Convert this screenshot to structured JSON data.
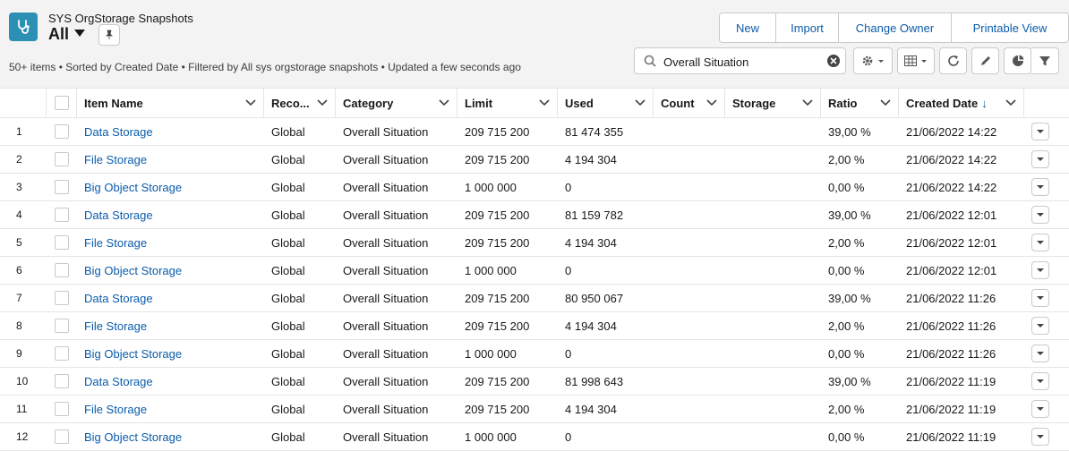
{
  "header": {
    "object_title": "SYS OrgStorage Snapshots",
    "view_name": "All",
    "meta": "50+ items • Sorted by Created Date • Filtered by All sys orgstorage snapshots • Updated a few seconds ago",
    "buttons": [
      "New",
      "Import",
      "Change Owner",
      "Printable View"
    ],
    "search_value": "Overall Situation",
    "accent_color": "#2c8fb4",
    "link_color": "#0b5cab"
  },
  "table": {
    "columns": [
      "Item Name",
      "Reco...",
      "Category",
      "Limit",
      "Used",
      "Count",
      "Storage",
      "Ratio",
      "Created Date"
    ],
    "rows": [
      {
        "n": "1",
        "name": "Data Storage",
        "reco": "Global",
        "category": "Overall Situation",
        "limit": "209 715 200",
        "used": "81 474 355",
        "count": "",
        "storage": "",
        "ratio": "39,00 %",
        "created": "21/06/2022 14:22"
      },
      {
        "n": "2",
        "name": "File Storage",
        "reco": "Global",
        "category": "Overall Situation",
        "limit": "209 715 200",
        "used": "4 194 304",
        "count": "",
        "storage": "",
        "ratio": "2,00 %",
        "created": "21/06/2022 14:22"
      },
      {
        "n": "3",
        "name": "Big Object Storage",
        "reco": "Global",
        "category": "Overall Situation",
        "limit": "1 000 000",
        "used": "0",
        "count": "",
        "storage": "",
        "ratio": "0,00 %",
        "created": "21/06/2022 14:22"
      },
      {
        "n": "4",
        "name": "Data Storage",
        "reco": "Global",
        "category": "Overall Situation",
        "limit": "209 715 200",
        "used": "81 159 782",
        "count": "",
        "storage": "",
        "ratio": "39,00 %",
        "created": "21/06/2022 12:01"
      },
      {
        "n": "5",
        "name": "File Storage",
        "reco": "Global",
        "category": "Overall Situation",
        "limit": "209 715 200",
        "used": "4 194 304",
        "count": "",
        "storage": "",
        "ratio": "2,00 %",
        "created": "21/06/2022 12:01"
      },
      {
        "n": "6",
        "name": "Big Object Storage",
        "reco": "Global",
        "category": "Overall Situation",
        "limit": "1 000 000",
        "used": "0",
        "count": "",
        "storage": "",
        "ratio": "0,00 %",
        "created": "21/06/2022 12:01"
      },
      {
        "n": "7",
        "name": "Data Storage",
        "reco": "Global",
        "category": "Overall Situation",
        "limit": "209 715 200",
        "used": "80 950 067",
        "count": "",
        "storage": "",
        "ratio": "39,00 %",
        "created": "21/06/2022 11:26"
      },
      {
        "n": "8",
        "name": "File Storage",
        "reco": "Global",
        "category": "Overall Situation",
        "limit": "209 715 200",
        "used": "4 194 304",
        "count": "",
        "storage": "",
        "ratio": "2,00 %",
        "created": "21/06/2022 11:26"
      },
      {
        "n": "9",
        "name": "Big Object Storage",
        "reco": "Global",
        "category": "Overall Situation",
        "limit": "1 000 000",
        "used": "0",
        "count": "",
        "storage": "",
        "ratio": "0,00 %",
        "created": "21/06/2022 11:26"
      },
      {
        "n": "10",
        "name": "Data Storage",
        "reco": "Global",
        "category": "Overall Situation",
        "limit": "209 715 200",
        "used": "81 998 643",
        "count": "",
        "storage": "",
        "ratio": "39,00 %",
        "created": "21/06/2022 11:19"
      },
      {
        "n": "11",
        "name": "File Storage",
        "reco": "Global",
        "category": "Overall Situation",
        "limit": "209 715 200",
        "used": "4 194 304",
        "count": "",
        "storage": "",
        "ratio": "2,00 %",
        "created": "21/06/2022 11:19"
      },
      {
        "n": "12",
        "name": "Big Object Storage",
        "reco": "Global",
        "category": "Overall Situation",
        "limit": "1 000 000",
        "used": "0",
        "count": "",
        "storage": "",
        "ratio": "0,00 %",
        "created": "21/06/2022 11:19"
      }
    ]
  }
}
